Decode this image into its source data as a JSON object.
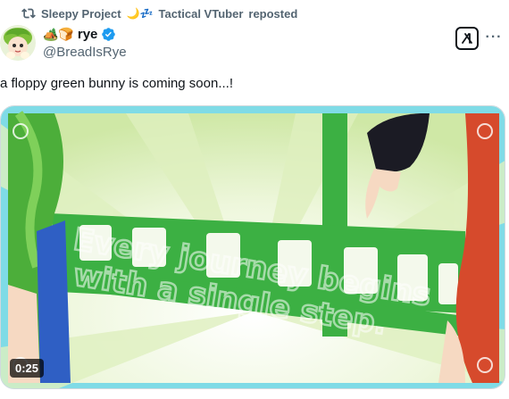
{
  "repost": {
    "icon": "repost-icon",
    "account": "Sleepy Project",
    "emoji": "🌙💤",
    "reposter": "Tactical VTuber",
    "suffix": "reposted"
  },
  "author": {
    "display_name": "rye",
    "name_emojis": "🏕️🍞",
    "handle": "@BreadIsRye",
    "verified": true,
    "verified_color": "#1d9bf0"
  },
  "post": {
    "text": "a floppy green bunny is coming soon...!"
  },
  "media": {
    "type": "video",
    "duration": "0:25",
    "overlay_text_line1": "Every journey begins",
    "overlay_text_line2": "with a single step.",
    "frame_color": "#7fdbe6",
    "film_strip_color": "#3cb043"
  },
  "actions": {
    "grok_icon": "grok-icon",
    "more_icon": "more-icon",
    "more_label": "···"
  }
}
